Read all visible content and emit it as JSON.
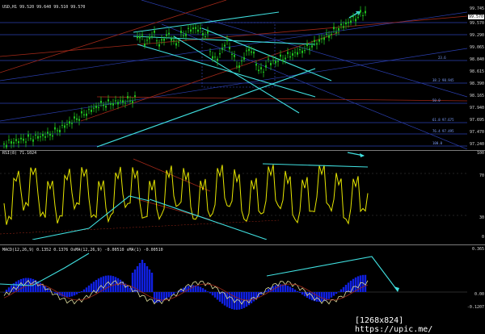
{
  "main": {
    "header": "USD,H1  99.520 99.640 99.510 99.570",
    "axis": [
      "99.745",
      "99.570",
      "99.290",
      "99.065",
      "98.840",
      "98.615",
      "98.390",
      "98.165",
      "97.940",
      "97.695",
      "97.470",
      "97.240"
    ],
    "price_tag": "99.570",
    "fib_labels": [
      "23.6",
      "38.2 98.945",
      "50.0",
      "61.8 97.675",
      "76.4 97.495",
      "100.0"
    ]
  },
  "rsi": {
    "header": "RSI(8) 71.1024",
    "axis": [
      "100",
      "70",
      "30",
      "0"
    ]
  },
  "macd": {
    "header": "MACD(12,26,9) 0.1352 0.1376  OsMA(12,26,9) -0.00510  sMA(1) -0.00510",
    "axis": [
      "0.365",
      "0.00",
      "-0.1207"
    ]
  },
  "colors": {
    "candle_up": "#1fbf1f",
    "candle_down": "#1fbf1f",
    "trend_cyan": "#40e0e0",
    "level_blue": "#2b3fb0",
    "fib_red": "#a02818",
    "rsi_line": "#e6e600",
    "macd_hist": "#1020e0",
    "signal": "#e0e0a0"
  },
  "watermark": "[1268x824] https://upic.me/"
}
